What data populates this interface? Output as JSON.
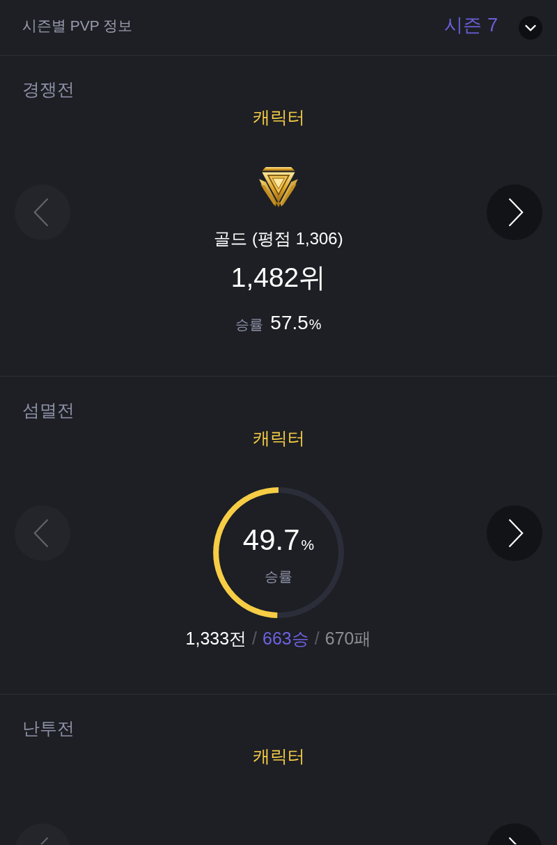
{
  "header": {
    "title": "시즌별 PVP 정보",
    "season": "시즌 7"
  },
  "sections": [
    {
      "kind": "rank",
      "title": "경쟁전",
      "subtitle": "캐릭터",
      "nav": [
        {
          "kind": "prev",
          "disabled": true
        },
        {
          "kind": "next",
          "disabled": false
        }
      ],
      "tier": "골드 (평점 1,306)",
      "rank": "1,482위",
      "win_rate": {
        "label": "승률",
        "value": "57.5",
        "unit": "%"
      }
    },
    {
      "kind": "donut",
      "title": "섬멸전",
      "subtitle": "캐릭터",
      "nav": [
        {
          "kind": "prev",
          "disabled": true
        },
        {
          "kind": "next",
          "disabled": false
        }
      ],
      "win_rate": {
        "label": "승률",
        "value": "49.7",
        "unit": "%",
        "level": 0.497
      },
      "record": [
        {
          "kind": "total",
          "text": "1,333전"
        },
        {
          "kind": "separator",
          "text": "/"
        },
        {
          "kind": "wins",
          "text": "663승"
        },
        {
          "kind": "separator",
          "text": "/"
        },
        {
          "kind": "losses",
          "text": "670패"
        }
      ]
    },
    {
      "kind": "partial",
      "title": "난투전",
      "subtitle": "캐릭터",
      "nav": [
        {
          "kind": "prev",
          "disabled": true
        },
        {
          "kind": "next",
          "disabled": false
        }
      ]
    }
  ]
}
